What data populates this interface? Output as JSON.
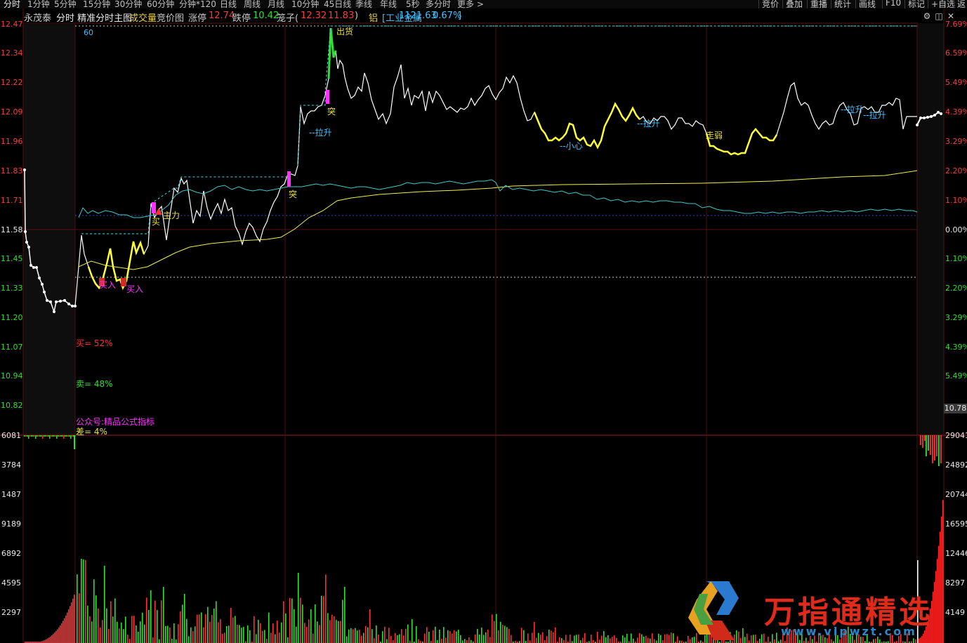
{
  "periods": [
    "分时",
    "1分钟",
    "5分钟",
    "15分钟",
    "30分钟",
    "60分钟",
    "分钟*120",
    "日线",
    "周线",
    "月线",
    "10分钟",
    "45日线",
    "季线",
    "年线",
    "5秒",
    "多分时",
    "更多 >"
  ],
  "right_buttons": [
    "竞价",
    "叠加",
    "重播",
    "统计",
    "画线",
    "F10",
    "标记",
    "+自选",
    "返"
  ],
  "info": {
    "stock_name": "永茂泰",
    "chart_name": "分时 精准分时主图",
    "volume_label": "成交量",
    "auction_label": "竞价图",
    "limit_up_label": "涨停",
    "limit_up_value": "12.74",
    "limit_down_label": "跌停",
    "limit_down_value": "10.42",
    "cage_label": "笼子(",
    "cage_high": "12.32",
    "cage_low": "11.83",
    "cage_close": ")",
    "metal_label": "铝",
    "sector_label": "[工业金属",
    "sector_value": "1121.63",
    "sector_change": "0.67%",
    "sector_close": "]"
  },
  "price_axis": [
    "12.47",
    "12.34",
    "12.22",
    "12.09",
    "11.96",
    "11.83",
    "11.71",
    "11.58",
    "11.45",
    "11.33",
    "11.20",
    "11.07",
    "10.94",
    "10.82"
  ],
  "pct_axis": [
    "7.69%",
    "6.59%",
    "5.49%",
    "4.39%",
    "3.29%",
    "2.20%",
    "1.10%",
    "0.00%",
    "1.10%",
    "2.20%",
    "3.29%",
    "4.39%",
    "5.49%"
  ],
  "volume_axis_left": [
    "6081",
    "3784",
    "1487",
    "9189",
    "6892",
    "4595",
    "2297"
  ],
  "volume_axis_right": [
    "29041",
    "24892",
    "20744",
    "16595",
    "12446",
    "8297",
    "4149"
  ],
  "current_price": "10.78",
  "period_marker": "60",
  "annotations": {
    "chuhuo": "出货",
    "tu1": "突",
    "tu2": "突",
    "lasheng1": "--拉升",
    "lasheng2": "--拉升",
    "lasheng3": "--拉升",
    "xiaoxin": "--小心",
    "zouruo": "走弱",
    "zhuli": "主力",
    "mai1": "买",
    "mairu1": "买入",
    "mairu2": "买入"
  },
  "stats": {
    "buy": "买= 52%",
    "sell": "卖= 48%",
    "source": "公众号:精品公式指标",
    "diff": "差= 4%"
  },
  "watermark": {
    "text": "万指通精选",
    "url": "www.vipwzt.com"
  },
  "colors": {
    "background": "#000000",
    "price_line": "#ffffff",
    "highlight": "#ffff33",
    "avg_line": "#f0f050",
    "cyan_line": "#3fc8c8",
    "up": "#ff3030",
    "down": "#30e030",
    "magenta": "#ff30ff",
    "label_cyan": "#40c0ff"
  }
}
